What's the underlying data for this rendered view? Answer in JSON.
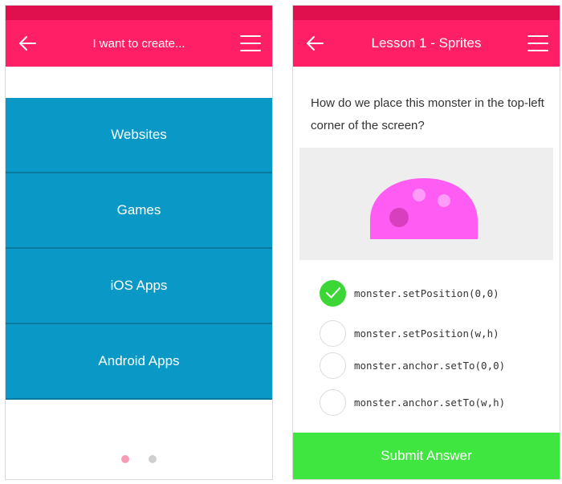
{
  "left_screen": {
    "header": {
      "title": "I want to create...",
      "back_icon": "back-arrow-icon",
      "menu_icon": "hamburger-menu-icon"
    },
    "items": [
      {
        "label": "Websites"
      },
      {
        "label": "Games"
      },
      {
        "label": "iOS Apps"
      },
      {
        "label": "Android Apps"
      }
    ],
    "pager": {
      "pages": 2,
      "active_page": 1
    }
  },
  "right_screen": {
    "header": {
      "title": "Lesson 1 - Sprites",
      "back_icon": "back-arrow-icon",
      "menu_icon": "hamburger-menu-icon"
    },
    "question": "How do we place this monster in the top-left corner of the screen?",
    "options": [
      {
        "code": "monster.setPosition(0,0)",
        "selected": true
      },
      {
        "code": "monster.setPosition(w,h)",
        "selected": false
      },
      {
        "code": "monster.anchor.setTo(0,0)",
        "selected": false
      },
      {
        "code": "monster.anchor.setTo(w,h)",
        "selected": false
      }
    ],
    "submit_label": "Submit Answer"
  },
  "colors": {
    "header": "#ff1f66",
    "status_bar": "#e0104f",
    "menu_item": "#0a99c6",
    "submit": "#3ee63f",
    "check": "#3dd637",
    "monster": "#ff5cf4"
  }
}
